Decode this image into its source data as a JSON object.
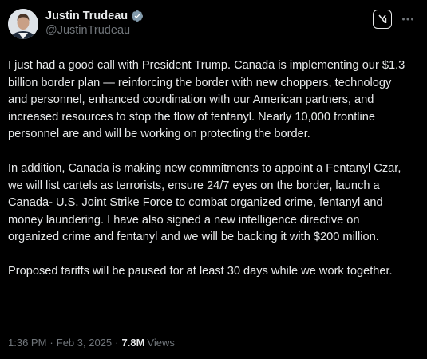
{
  "author": {
    "display_name": "Justin Trudeau",
    "handle": "@JustinTrudeau",
    "verified": true,
    "verified_color": "#1d9bf0"
  },
  "header_icons": {
    "grok": "grok-icon",
    "more": "more-horizontal-icon"
  },
  "body": {
    "paragraphs": [
      "I just had a good call with President Trump. Canada is implementing our $1.3 billion border plan — reinforcing the border with new choppers, technology and personnel, enhanced coordination with our American partners, and increased resources to stop the flow of fentanyl. Nearly 10,000 frontline personnel are and will be working on protecting the border.",
      "In addition, Canada is making new commitments to appoint a Fentanyl Czar, we will list cartels as terrorists, ensure 24/7 eyes on the border, launch a Canada- U.S. Joint Strike Force to combat organized crime, fentanyl and money laundering. I have also signed a new intelligence directive on organized crime and fentanyl and we will be backing it with $200 million.",
      "Proposed tariffs will be paused for at least 30 days while we work together."
    ]
  },
  "meta": {
    "time": "1:36 PM",
    "separator": "·",
    "date": "Feb 3, 2025",
    "views_count": "7.8M",
    "views_label": "Views"
  },
  "colors": {
    "background": "#000000",
    "text": "#e7e9ea",
    "secondary_text": "#71767b"
  }
}
